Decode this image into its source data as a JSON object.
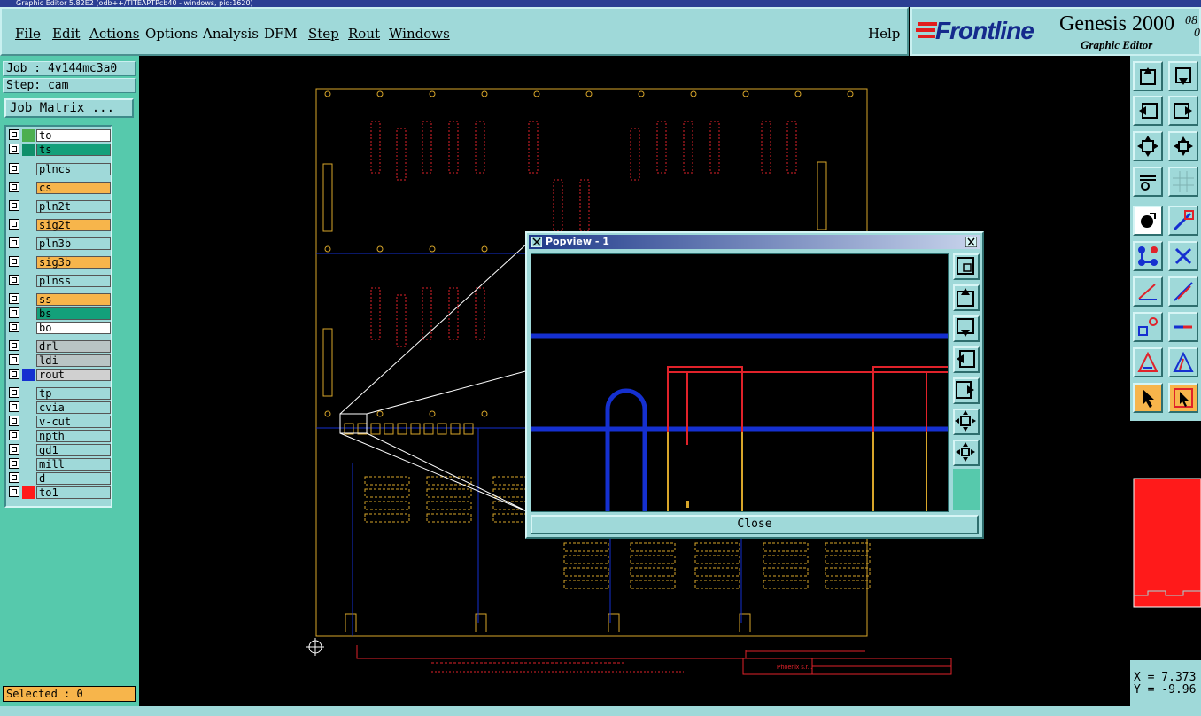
{
  "window": {
    "title": "Graphic Editor 5.82E2 (odb++/TITEAPTPcb40 - windows, pid:1620)"
  },
  "menu": {
    "items": [
      {
        "label": "File"
      },
      {
        "label": "Edit"
      },
      {
        "label": "Actions"
      },
      {
        "label": "Options"
      },
      {
        "label": "Analysis"
      },
      {
        "label": "DFM"
      },
      {
        "label": "Step"
      },
      {
        "label": "Rout"
      },
      {
        "label": "Windows"
      }
    ],
    "help": "Help"
  },
  "logo": {
    "brand": "Frontline",
    "product": "Genesis 2000",
    "subtitle": "Graphic Editor",
    "version_top": "08",
    "version_bottom": "0"
  },
  "job": {
    "label": "Job : 4v144mc3a0",
    "step": "Step: cam",
    "matrix_button": "Job Matrix ..."
  },
  "layers": [
    {
      "name": "to",
      "color": "#4caf50",
      "bg": "#ffffff"
    },
    {
      "name": "ts",
      "color": "#0f8f6a",
      "bg": "#13a07a"
    },
    {
      "name": "plncs",
      "color": "",
      "bg": "#9fd9d9"
    },
    {
      "name": "cs",
      "color": "",
      "bg": "#f7b54b"
    },
    {
      "name": "pln2t",
      "color": "",
      "bg": "#9fd9d9"
    },
    {
      "name": "sig2t",
      "color": "",
      "bg": "#f7b54b"
    },
    {
      "name": "pln3b",
      "color": "",
      "bg": "#9fd9d9"
    },
    {
      "name": "sig3b",
      "color": "",
      "bg": "#f7b54b"
    },
    {
      "name": "plnss",
      "color": "",
      "bg": "#9fd9d9"
    },
    {
      "name": "ss",
      "color": "",
      "bg": "#f7b54b"
    },
    {
      "name": "bs",
      "color": "",
      "bg": "#13a07a"
    },
    {
      "name": "bo",
      "color": "",
      "bg": "#ffffff"
    },
    {
      "name": "drl",
      "color": "",
      "bg": "#b9c4c4"
    },
    {
      "name": "ldi",
      "color": "",
      "bg": "#b9c4c4"
    },
    {
      "name": "rout",
      "color": "#1530d0",
      "bg": "#d0d0d0"
    },
    {
      "name": "tp",
      "color": "",
      "bg": "#9fd9d9"
    },
    {
      "name": "cvia",
      "color": "",
      "bg": "#9fd9d9"
    },
    {
      "name": "v-cut",
      "color": "",
      "bg": "#9fd9d9"
    },
    {
      "name": "npth",
      "color": "",
      "bg": "#9fd9d9"
    },
    {
      "name": "gd1",
      "color": "",
      "bg": "#9fd9d9"
    },
    {
      "name": "mill",
      "color": "",
      "bg": "#9fd9d9"
    },
    {
      "name": "d",
      "color": "",
      "bg": "#9fd9d9"
    },
    {
      "name": "to1",
      "color": "#ff1a1a",
      "bg": "#9fd9d9"
    }
  ],
  "status": {
    "selected": "Selected : 0"
  },
  "coords": {
    "x": "X = 7.373",
    "y": "Y = -9.96"
  },
  "popview": {
    "title": "Popview - 1",
    "close": "Close"
  },
  "board": {
    "company": "Phoenix s.r.l."
  },
  "colors": {
    "teal": "#9fd9d9",
    "green_panel": "#56c9ac",
    "orange": "#f7b54b",
    "layer_blue": "#1530d0",
    "layer_red": "#ff1a1a",
    "layer_gold": "#d8a62a"
  }
}
